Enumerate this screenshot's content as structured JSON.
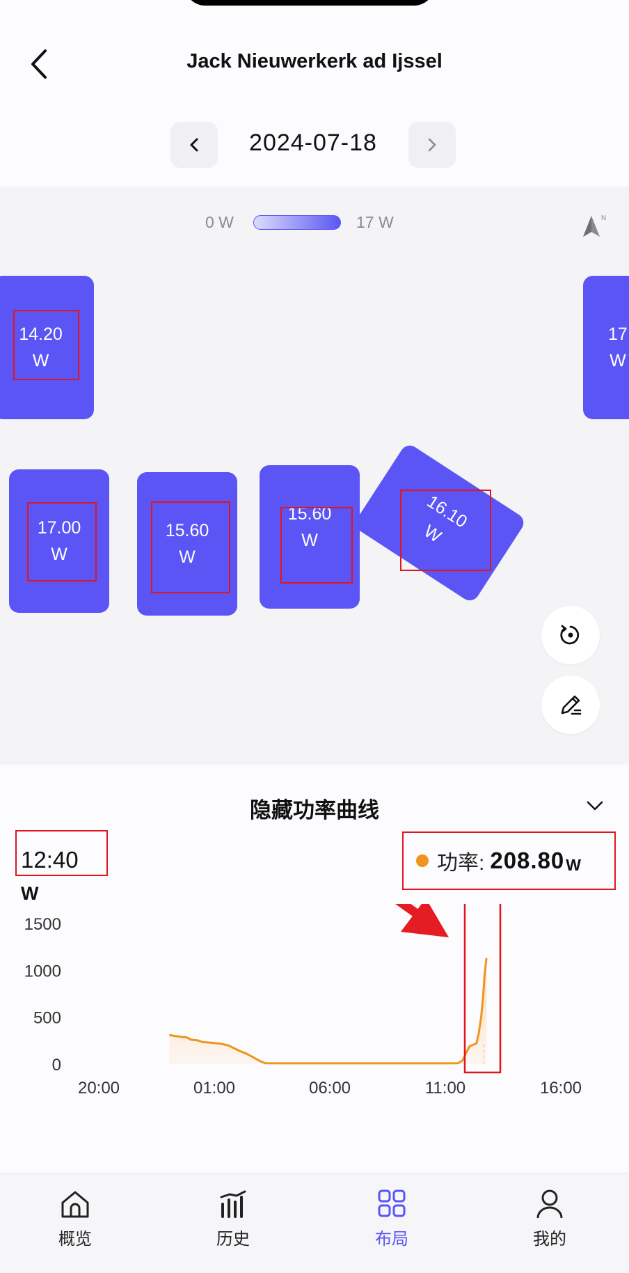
{
  "header": {
    "title": "Jack Nieuwerkerk ad Ijssel",
    "back_icon": "chevron-left-icon"
  },
  "date_nav": {
    "date": "2024-07-18",
    "prev_icon": "chevron-left-icon",
    "next_icon": "chevron-right-icon"
  },
  "legend": {
    "min": "0 W",
    "max": "17 W",
    "compass_label": "N"
  },
  "panels": [
    {
      "value": "14.20",
      "unit": "W"
    },
    {
      "value": "17",
      "unit": "W"
    },
    {
      "value": "17.00",
      "unit": "W"
    },
    {
      "value": "15.60",
      "unit": "W"
    },
    {
      "value": "15.60",
      "unit": "W"
    },
    {
      "value": "16.10",
      "unit": "W"
    }
  ],
  "fabs": {
    "rotate_icon": "rotate-icon",
    "edit_icon": "edit-pen-icon"
  },
  "chart_panel": {
    "toggle_label": "隐藏功率曲线",
    "time": "12:40",
    "power_label": "功率:",
    "power_value": "208.80",
    "power_unit": "W",
    "y_unit": "W"
  },
  "chart_data": {
    "type": "area",
    "ylabel": "W",
    "ylim": [
      0,
      1500
    ],
    "yticks": [
      "1500",
      "1000",
      "500",
      "0"
    ],
    "xticks": [
      "20:00",
      "01:00",
      "06:00",
      "11:00",
      "16:00"
    ],
    "color": "#f0941e",
    "series": [
      {
        "x_hours": [
          -0.95,
          -0.7,
          -0.45,
          -0.2,
          0.0,
          0.25,
          0.5,
          0.75,
          1.0,
          1.3,
          1.6,
          1.85,
          2.1,
          2.4,
          2.7,
          3.0,
          3.2,
          4.0,
          6.0,
          8.0,
          10.0,
          11.0,
          11.55,
          11.75,
          11.9,
          12.05,
          12.2,
          12.35,
          12.45,
          12.55,
          12.63,
          12.7,
          12.78
        ],
        "values": [
          310,
          300,
          290,
          285,
          260,
          255,
          235,
          230,
          225,
          215,
          200,
          170,
          140,
          110,
          70,
          30,
          10,
          8,
          8,
          8,
          8,
          8,
          10,
          40,
          120,
          190,
          205,
          220,
          330,
          500,
          700,
          950,
          1130
        ]
      }
    ],
    "cursor_time": "12:40"
  },
  "tabbar": [
    {
      "label": "概览",
      "icon": "home-icon",
      "active": false
    },
    {
      "label": "历史",
      "icon": "history-chart-icon",
      "active": false
    },
    {
      "label": "布局",
      "icon": "layout-grid-icon",
      "active": true
    },
    {
      "label": "我的",
      "icon": "user-icon",
      "active": false
    }
  ]
}
